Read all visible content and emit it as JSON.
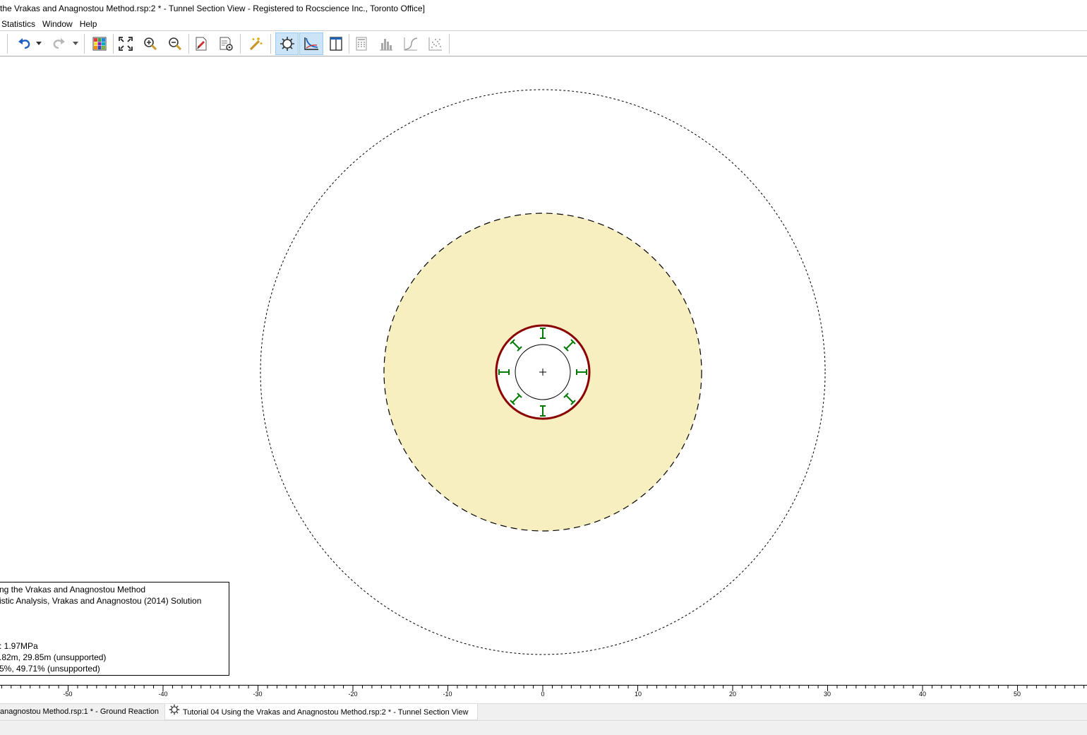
{
  "window": {
    "title": "the Vrakas and Anagnostou Method.rsp:2 * - Tunnel Section View - Registered to Rocscience Inc., Toronto Office]"
  },
  "menu": {
    "items": [
      "Statistics",
      "Window",
      "Help"
    ]
  },
  "toolbar": {
    "icons": [
      "undo-icon",
      "dropdown-arrow-icon",
      "redo-icon",
      "dropdown-arrow-icon",
      "color-grid-icon",
      "zoom-all-icon",
      "zoom-in-icon",
      "zoom-out-icon",
      "edit-properties-icon",
      "document-settings-icon",
      "magic-wand-icon",
      "tunnel-section-icon",
      "ground-reaction-chart-icon",
      "split-view-icon",
      "calculator-icon",
      "histogram-icon",
      "cumulative-curve-icon",
      "scatter-plot-icon"
    ],
    "active": [
      "tunnel-section-icon",
      "ground-reaction-chart-icon"
    ]
  },
  "info_panel": {
    "line1": "ng the Vrakas and Anagnostou Method",
    "line2": "istic Analysis,   Vrakas and Anagnostou (2014) Solution",
    "line3": ":   1.97MPa",
    "line4": ".82m,   29.85m (unsupported)",
    "line5": "5%,   49.71% (unsupported)"
  },
  "ruler": {
    "ticks": [
      "-50",
      "-40",
      "-30",
      "-20",
      "-10",
      "0",
      "10",
      "20",
      "30",
      "40",
      "50"
    ]
  },
  "tabs": [
    {
      "label": "anagnostou Method.rsp:1 * - Ground Reaction",
      "active": false
    },
    {
      "label": "Tutorial 04 Using the Vrakas and Anagnostou Method.rsp:2 * - Tunnel Section View",
      "active": true
    }
  ],
  "colors": {
    "plastic_zone": "#f8efc1",
    "liner": "#8b0000",
    "bolts": "#007a00",
    "active_button": "#cce4f7"
  }
}
